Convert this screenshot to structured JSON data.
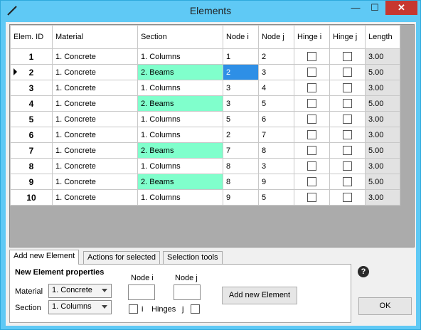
{
  "window": {
    "title": "Elements",
    "minimize": "—",
    "maximize": "☐",
    "close": "✕"
  },
  "grid": {
    "headers": [
      "Elem. ID",
      "Material",
      "Section",
      "Node i",
      "Node j",
      "Hinge i",
      "Hinge j",
      "Length"
    ],
    "rows": [
      {
        "id": "1",
        "material": "1. Concrete",
        "section": "1. Columns",
        "node_i": "1",
        "node_j": "2",
        "length": "3.00"
      },
      {
        "id": "2",
        "material": "1. Concrete",
        "section": "2. Beams",
        "node_i": "2",
        "node_j": "3",
        "length": "5.00"
      },
      {
        "id": "3",
        "material": "1. Concrete",
        "section": "1. Columns",
        "node_i": "3",
        "node_j": "4",
        "length": "3.00"
      },
      {
        "id": "4",
        "material": "1. Concrete",
        "section": "2. Beams",
        "node_i": "3",
        "node_j": "5",
        "length": "5.00"
      },
      {
        "id": "5",
        "material": "1. Concrete",
        "section": "1. Columns",
        "node_i": "5",
        "node_j": "6",
        "length": "3.00"
      },
      {
        "id": "6",
        "material": "1. Concrete",
        "section": "1. Columns",
        "node_i": "2",
        "node_j": "7",
        "length": "3.00"
      },
      {
        "id": "7",
        "material": "1. Concrete",
        "section": "2. Beams",
        "node_i": "7",
        "node_j": "8",
        "length": "5.00"
      },
      {
        "id": "8",
        "material": "1. Concrete",
        "section": "1. Columns",
        "node_i": "8",
        "node_j": "3",
        "length": "3.00"
      },
      {
        "id": "9",
        "material": "1. Concrete",
        "section": "2. Beams",
        "node_i": "8",
        "node_j": "9",
        "length": "5.00"
      },
      {
        "id": "10",
        "material": "1. Concrete",
        "section": "1. Columns",
        "node_i": "9",
        "node_j": "5",
        "length": "3.00"
      }
    ]
  },
  "tabs": [
    "Add new Element",
    "Actions for selected",
    "Selection tools"
  ],
  "panel": {
    "heading": "New Element properties",
    "material_label": "Material",
    "material_value": "1. Concrete",
    "section_label": "Section",
    "section_value": "1. Columns",
    "node_i_label": "Node i",
    "node_j_label": "Node j",
    "hinge_i_label": "i",
    "hinges_label": "Hinges",
    "hinge_j_label": "j",
    "add_button": "Add new Element"
  },
  "help_label": "?",
  "ok_button": "OK",
  "colors": {
    "beam_highlight": "#80ffcc",
    "selected_cell": "#2e8fe6",
    "titlebar": "#5fc9f5",
    "close": "#c7372f"
  }
}
